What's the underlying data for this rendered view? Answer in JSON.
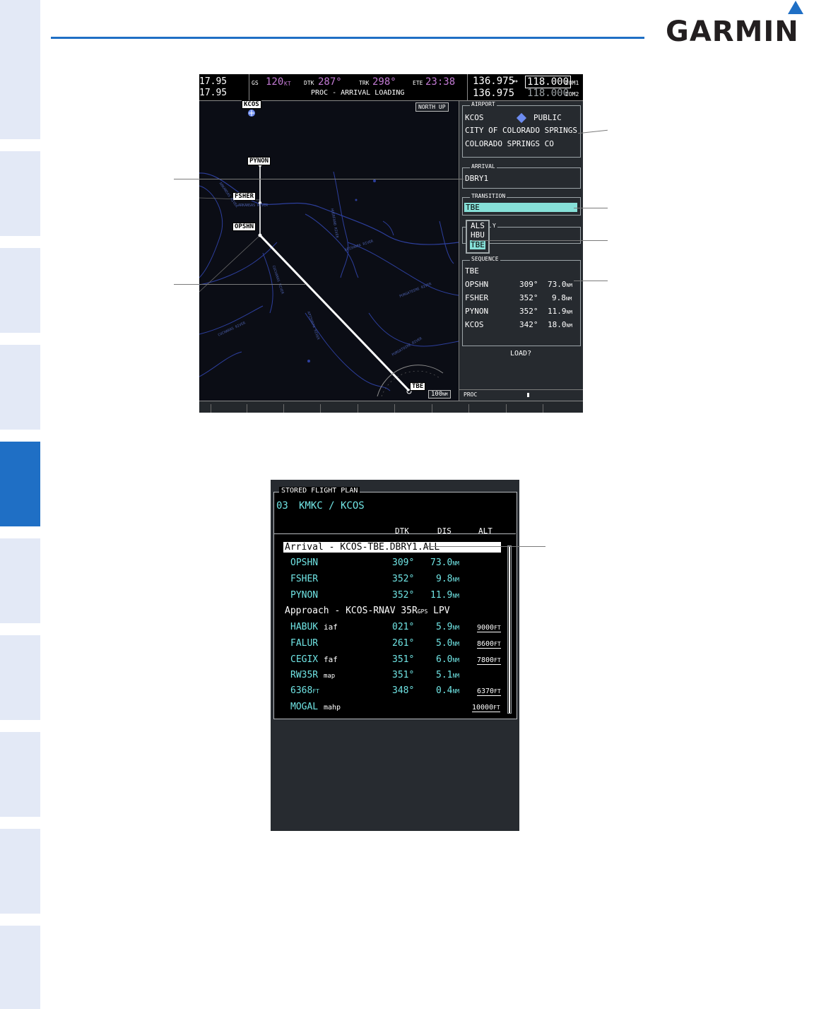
{
  "brand": {
    "logo_text": "GARMIN"
  },
  "mfd": {
    "nav1_active": "17.95",
    "nav2_active": "17.95",
    "gs_label": "GS",
    "gs_value": "120",
    "gs_unit": "KT",
    "dtk_label": "DTK",
    "dtk_value": "287°",
    "trk_label": "TRK",
    "trk_value": "298°",
    "ete_label": "ETE",
    "ete_value": "23:38",
    "page_title": "PROC - ARRIVAL LOADING",
    "com1_active": "136.975",
    "com1_arrow": "↔",
    "com1_standby": "118.000",
    "com1_label": "COM1",
    "com2_active": "136.975",
    "com2_standby": "118.000",
    "com2_label": "COM2",
    "north_up": "NORTH UP",
    "map_range": "100",
    "map_range_unit": "NM",
    "waypoints": {
      "kcos": "KCOS",
      "pynon": "PYNON",
      "fsher": "FSHER",
      "opshn": "OPSHN",
      "tbe": "TBE"
    },
    "rivers": {
      "arkansas_1": "ARKANSAS RIVER",
      "arkansas_2": "ARKANSAS RIVER",
      "huerfano": "HUERFANO RIVER",
      "apishapa_1": "APISHAPA RIVER",
      "cucharas": "CUCHARAS RIVER",
      "purgatoire_1": "PURGATOIRE RIVER",
      "apishapa_2": "APISHAPA RIVER",
      "purgatoire_2": "PURGATOIRE RIVER",
      "cucharas_2": "CUCHARAS RIVER"
    },
    "airport": {
      "title": "AIRPORT",
      "id": "KCOS",
      "type": "PUBLIC",
      "name": "CITY OF COLORADO SPRINGS",
      "location": "COLORADO SPRINGS CO"
    },
    "arrival": {
      "title": "ARRIVAL",
      "value": "DBRY1"
    },
    "transition": {
      "title": "TRANSITION",
      "selected": "TBE",
      "options": [
        "ALS",
        "HBU",
        "TBE"
      ],
      "partial_label": "Y"
    },
    "sequence": {
      "title": "SEQUENCE",
      "start": "TBE",
      "rows": [
        {
          "wpt": "OPSHN",
          "dtk": "309°",
          "dis": "73.0",
          "unit": "NM"
        },
        {
          "wpt": "FSHER",
          "dtk": "352°",
          "dis": "9.8",
          "unit": "NM"
        },
        {
          "wpt": "PYNON",
          "dtk": "352°",
          "dis": "11.9",
          "unit": "NM"
        },
        {
          "wpt": "KCOS",
          "dtk": "342°",
          "dis": "18.0",
          "unit": "NM"
        }
      ]
    },
    "load_prompt": "LOAD?",
    "proc_label": "PROC"
  },
  "fpl": {
    "title": "STORED FLIGHT PLAN",
    "plan_number": "03",
    "route": "KMKC / KCOS",
    "headers": {
      "dtk": "DTK",
      "dis": "DIS",
      "alt": "ALT"
    },
    "arrival_header": "Arrival - KCOS-TBE.DBRY1.ALL",
    "arrival_rows": [
      {
        "wpt": "OPSHN",
        "dtk": "309°",
        "dis": "73.0",
        "unit": "NM"
      },
      {
        "wpt": "FSHER",
        "dtk": "352°",
        "dis": "9.8",
        "unit": "NM"
      },
      {
        "wpt": "PYNON",
        "dtk": "352°",
        "dis": "11.9",
        "unit": "NM"
      }
    ],
    "approach_header": "Approach - KCOS-RNAV 35R",
    "approach_gps": "GPS",
    "approach_lpv": "LPV",
    "approach_rows": [
      {
        "wpt": "HABUK",
        "tag": "iaf",
        "dtk": "021°",
        "dis": "5.9",
        "unit": "NM",
        "alt": "9000",
        "alt_unit": "FT"
      },
      {
        "wpt": "FALUR",
        "tag": "",
        "dtk": "261°",
        "dis": "5.0",
        "unit": "NM",
        "alt": "8600",
        "alt_unit": "FT"
      },
      {
        "wpt": "CEGIX",
        "tag": "faf",
        "dtk": "351°",
        "dis": "6.0",
        "unit": "NM",
        "alt": "7800",
        "alt_unit": "FT"
      },
      {
        "wpt": "RW35R",
        "tag": "map",
        "dtk": "351°",
        "dis": "5.1",
        "unit": "NM",
        "alt": "",
        "alt_unit": ""
      },
      {
        "wpt": "6368",
        "wpt_unit": "FT",
        "tag": "",
        "dtk": "348°",
        "dis": "0.4",
        "unit": "NM",
        "alt": "6370",
        "alt_unit": "FT"
      },
      {
        "wpt": "MOGAL",
        "tag": "mahp",
        "dtk": "",
        "dis": "",
        "unit": "",
        "alt": "10000",
        "alt_unit": "FT"
      }
    ]
  },
  "colors": {
    "accent": "#1f6fc5",
    "tab_bg": "#e3e9f6",
    "magenta": "#c27ad3",
    "cyan": "#6fe3e3"
  }
}
